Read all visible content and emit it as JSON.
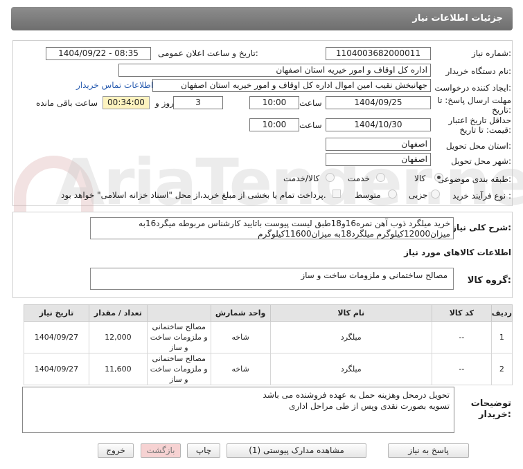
{
  "header": {
    "title": "جزئیات اطلاعات نیاز"
  },
  "fields": {
    "need_number_label": "شماره نیاز:",
    "need_number": "1104003682000011",
    "announce_label": "تاریخ و ساعت اعلان عمومی:",
    "announce_value": "1404/09/22 - 08:35",
    "buyer_org_label": "نام دستگاه خریدار:",
    "buyer_org": "اداره کل اوقاف و امور خیریه استان اصفهان",
    "requester_label": "ایجاد کننده درخواست:",
    "requester": "جهانبخش نقیب امین اموال اداره کل اوقاف و امور خیریه استان اصفهان",
    "contact_link": "اطلاعات تماس خریدار",
    "deadline_label_1": "مهلت ارسال پاسخ: تا",
    "deadline_label_2": "تاریخ:",
    "deadline_date": "1404/09/25",
    "time_label": "ساعت",
    "deadline_time": "10:00",
    "days_value": "3",
    "days_label": "روز و",
    "remaining_time": "00:34:00",
    "remaining_label": "ساعت باقی مانده",
    "validity_label_1": "حداقل تاریخ اعتبار",
    "validity_label_2": "قیمت: تا تاریخ:",
    "validity_date": "1404/10/30",
    "validity_time": "10:00",
    "province_label": "استان محل تحویل:",
    "province": "اصفهان",
    "city_label": "شهر محل تحویل:",
    "city": "اصفهان",
    "category_label": "طبقه بندی موضوعی:",
    "cat_opt_goods": "کالا",
    "cat_opt_service": "خدمت",
    "cat_opt_both": "کالا/خدمت",
    "process_label": "نوع فرآیند خرید :",
    "proc_opt_partial": "جزیی",
    "proc_opt_medium": "متوسط",
    "payment_note": "پرداخت تمام یا بخشی از مبلغ خرید،از محل \"اسناد خزانه اسلامی\" خواهد بود."
  },
  "description": {
    "label": "شرح کلی نیاز:",
    "text": "خرید میلگرد ذوب آهن نمره16و18طبق لیست پیوست باتایید کارشناس مربوطه میگرد16به میزان12000کیلوگرم میلگرد18به میزان11600کیلوگرم"
  },
  "items_section": {
    "title": "اطلاعات کالاهای مورد نیاز",
    "group_label": "گروه کالا:",
    "group_value": "مصالح ساختمانی و ملزومات ساخت و ساز"
  },
  "table": {
    "headers": [
      "ردیف",
      "کد کالا",
      "نام کالا",
      "واحد شمارش",
      "تعداد / مقدار",
      "تاریخ نیاز"
    ],
    "rows": [
      {
        "row": "1",
        "code": "--",
        "name": "میلگرد",
        "unit": "شاخه",
        "qty": "12,000",
        "date": "1404/09/27",
        "cat_a": "مصالح ساختمانی",
        "cat_b": "و ملزومات ساخت",
        "cat_c": "و ساز"
      },
      {
        "row": "2",
        "code": "--",
        "name": "میلگرد",
        "unit": "شاخه",
        "qty": "11,600",
        "date": "1404/09/27",
        "cat_a": "مصالح ساختمانی",
        "cat_b": "و ملزومات ساخت",
        "cat_c": "و ساز"
      }
    ]
  },
  "buyer_notes": {
    "label_1": "توضیحات",
    "label_2": "خریدار:",
    "line_1": "تحویل درمحل وهزینه حمل به عهده فروشنده می باشد",
    "line_2": "تسویه بصورت نقدی وپس از طی مراحل اداری"
  },
  "buttons": {
    "reply": "پاسخ به نیاز",
    "attachments": "مشاهده مدارک پیوستی (1)",
    "print": "چاپ",
    "back": "بازگشت",
    "exit": "خروج"
  },
  "watermark_text": "AriaTender.net"
}
